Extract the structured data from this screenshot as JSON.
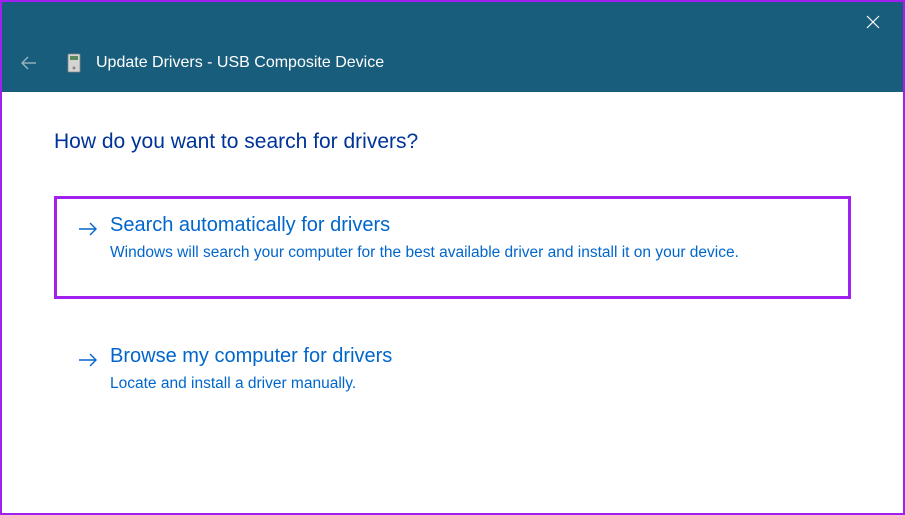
{
  "titlebar": {
    "close_icon": "close"
  },
  "header": {
    "back_icon": "back-arrow",
    "device_icon": "device",
    "title": "Update Drivers - USB Composite Device"
  },
  "content": {
    "question": "How do you want to search for drivers?",
    "options": [
      {
        "title": "Search automatically for drivers",
        "description": "Windows will search your computer for the best available driver and install it on your device.",
        "highlighted": true
      },
      {
        "title": "Browse my computer for drivers",
        "description": "Locate and install a driver manually.",
        "highlighted": false
      }
    ]
  }
}
